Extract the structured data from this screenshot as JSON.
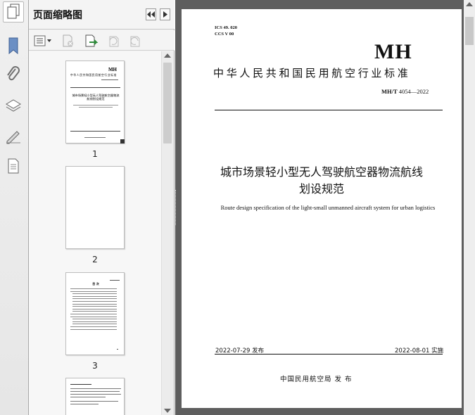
{
  "panel": {
    "title": "页面缩略图"
  },
  "thumbnails": [
    {
      "number": "1"
    },
    {
      "number": "2"
    },
    {
      "number": "3"
    }
  ],
  "document": {
    "ics": "ICS  49. 020",
    "ccs": "CCS  V  00",
    "logo": "MH",
    "standard_line": "中华人民共和国民用航空行业标准",
    "code_prefix": "MH/T",
    "code_number": "4054—2022",
    "title_cn_1": "城市场景轻小型无人驾驶航空器物流航线",
    "title_cn_2": "划设规范",
    "title_en": "Route design specification of the light-small unmanned aircraft system for urban logistics",
    "publish_date": "2022-07-29 发布",
    "implement_date": "2022-08-01 实施",
    "issuer": "中国民用航空局    发 布"
  },
  "thumb1": {
    "logo": "MH",
    "line": "中华人民共和国民用航空行业标准",
    "title": "城市场景轻小型无人驾驶航空器物流航线划设规范"
  },
  "thumb3": {
    "heading": "目  次"
  },
  "colors": {
    "accent": "#2a6fb0",
    "page_bg": "#5e5e5e"
  }
}
